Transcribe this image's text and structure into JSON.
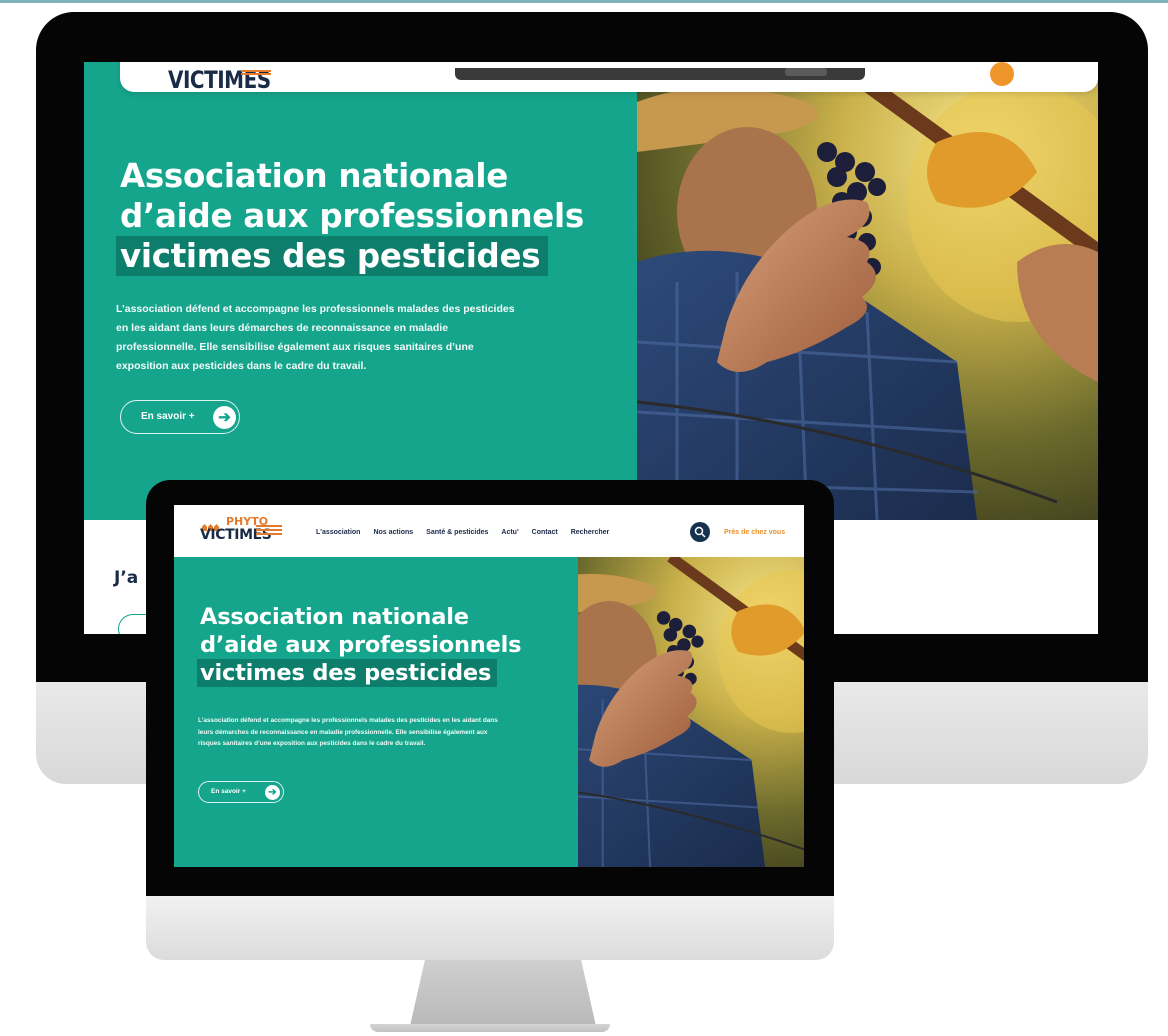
{
  "site": {
    "logo_top": "PHYTO",
    "logo_main": "VICTIMES",
    "logo_main_partial": "VICTIMES"
  },
  "nav": {
    "items": [
      "L'association",
      "Nos actions",
      "Santé & pesticides",
      "Actu'",
      "Contact",
      "Rechercher"
    ],
    "cta": "Près de chez vous"
  },
  "hero": {
    "title_line1": "Association nationale",
    "title_line2": "d’aide aux professionnels",
    "title_line3": "victimes des pesticides",
    "description": "L’association défend et accompagne les professionnels malades des pesticides en les aidant dans leurs démarches de reconnaissance en maladie professionnelle. Elle sensibilise également aux risques sanitaires d’une exposition aux pesticides dans le cadre du travail.",
    "button_label": "En savoir +",
    "button_icon": "arrow-right-icon"
  },
  "lower_section": {
    "heading_partial": "J’a"
  },
  "colors": {
    "brand_teal": "#15a58c",
    "title_highlight": "#0d7e6b",
    "navy": "#1a2b48",
    "orange": "#e47a2a"
  }
}
